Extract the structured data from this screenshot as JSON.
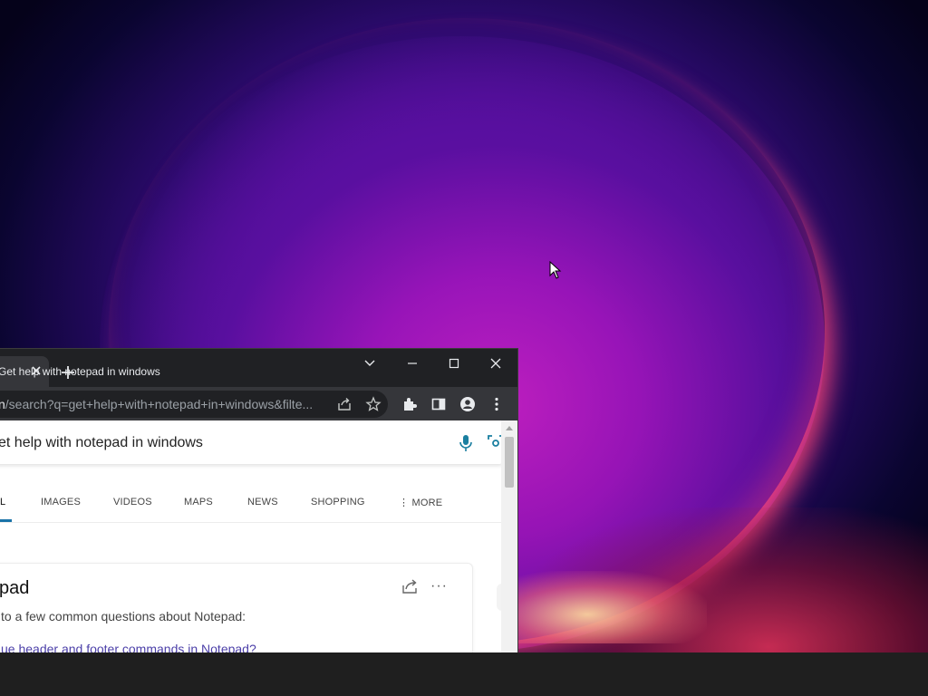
{
  "desktop": {
    "wallpaper": "windows-11-bloom"
  },
  "browser": {
    "tab": {
      "title": "Get help with notepad in windows"
    },
    "address_bar": {
      "url_host_tail": "n",
      "url_path": "/search?q=get+help+with+notepad+in+windows&filte..."
    },
    "page": {
      "search_query": "et help with notepad in windows",
      "nav_tabs": [
        {
          "label": "L",
          "active": true
        },
        {
          "label": "IMAGES"
        },
        {
          "label": "VIDEOS"
        },
        {
          "label": "MAPS"
        },
        {
          "label": "NEWS"
        },
        {
          "label": "SHOPPING"
        },
        {
          "label": "⋮ MORE"
        }
      ],
      "answer_card": {
        "title": "pad",
        "more": "···",
        "text": "to a few common questions about Notepad:",
        "link": "ue header and footer commands in Notepad?"
      }
    }
  },
  "colors": {
    "taskbar": "#1f1f1f",
    "titlebar": "#202124",
    "toolbar": "#35363a",
    "accent": "#1a73a8",
    "link": "#4b3fa8"
  }
}
